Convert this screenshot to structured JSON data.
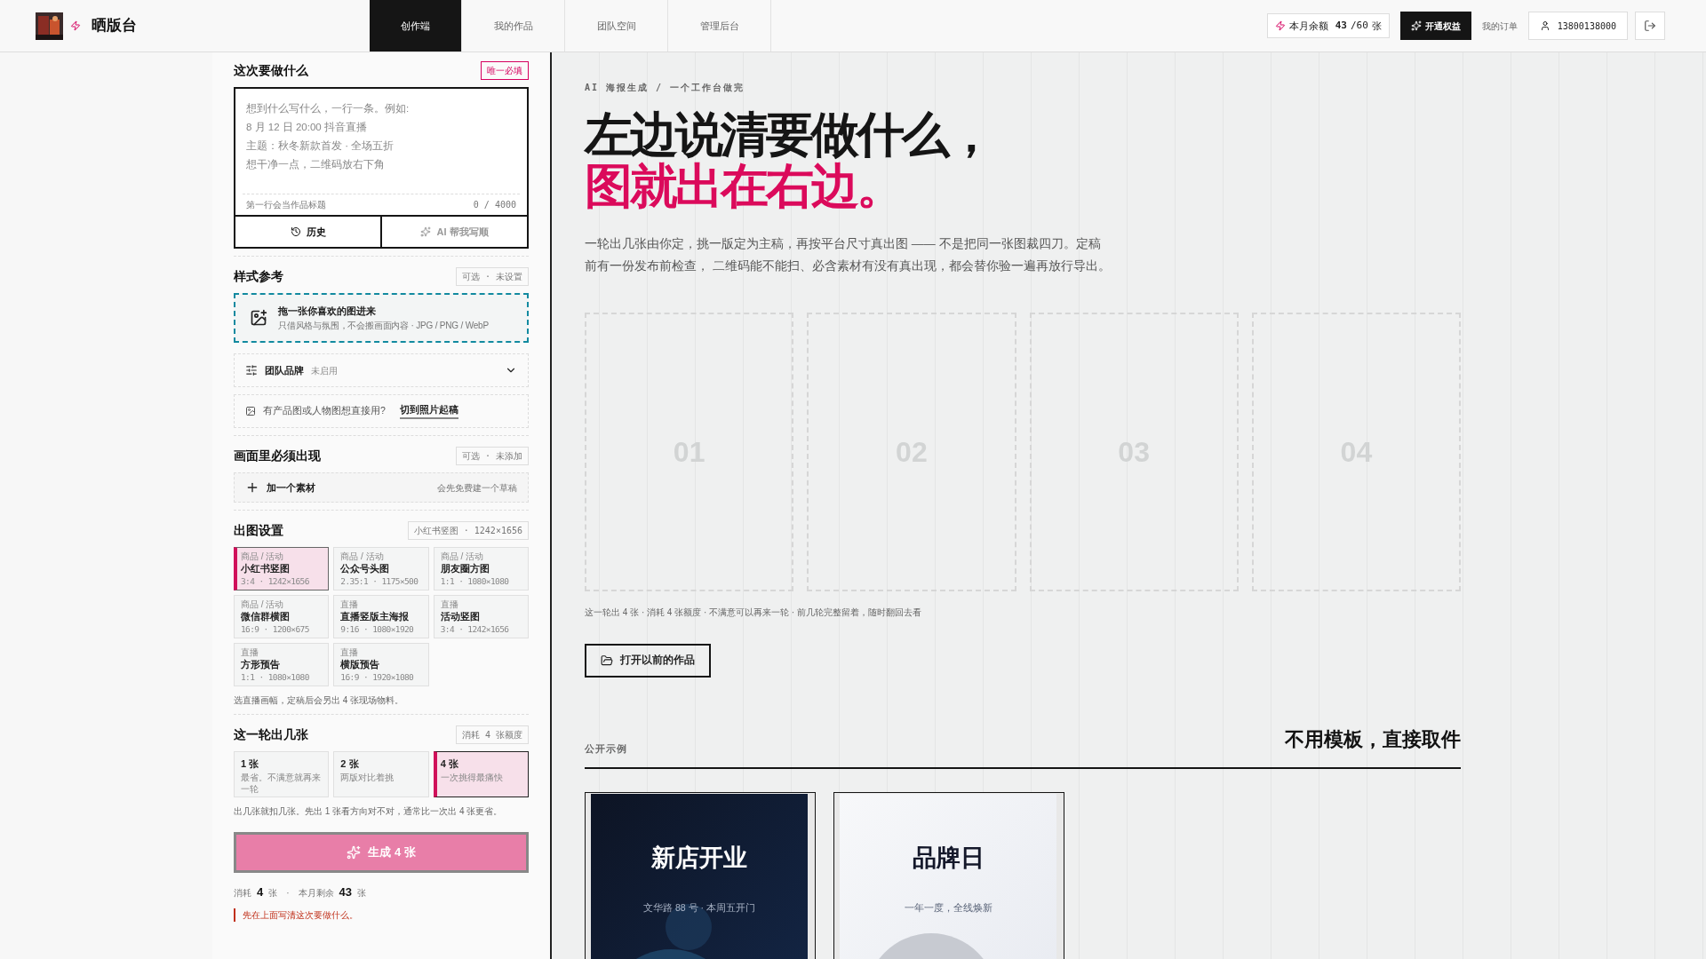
{
  "header": {
    "brand": "晒版台",
    "tabs": [
      {
        "label": "创作端",
        "selected": true
      },
      {
        "label": "我的作品",
        "selected": false
      },
      {
        "label": "团队空间",
        "selected": false
      },
      {
        "label": "管理后台",
        "selected": false
      }
    ],
    "quota": {
      "label": "本月余额",
      "value": "43",
      "total": "/60",
      "unit": "张"
    },
    "upgrade_button": "开通权益",
    "orders_link": "我的订单",
    "account": "13800138000"
  },
  "brief": {
    "title": "这次要做什么",
    "badge": "唯一必填",
    "placeholder": [
      "想到什么写什么，一行一条。例如:",
      "8 月 12 日 20:00 抖音直播",
      "主题：秋冬新款首发 · 全场五折",
      "想干净一点，二维码放右下角"
    ],
    "hint": "第一行会当作品标题",
    "counter": "0 / 4000",
    "buttons": [
      {
        "label": "历史",
        "kind": "history",
        "disabled": false
      },
      {
        "label": "AI 帮我写顺",
        "kind": "ai",
        "disabled": true
      }
    ]
  },
  "style_ref": {
    "title": "样式参考",
    "badge": "可选 · 未设置",
    "drop_title": "拖一张你喜欢的图进来",
    "drop_hint": "只借风格与氛围，不会搬画面内容 · JPG / PNG / WebP"
  },
  "team_brand": {
    "label": "团队品牌",
    "status": "未启用",
    "expanded": false
  },
  "photo_switch": {
    "question": "有产品图或人物图想直接用?",
    "link": "切到照片起稿"
  },
  "must_show": {
    "title": "画面里必须出现",
    "badge": "可选 · 未添加",
    "add_label": "加一个素材",
    "add_hint": "会先免费建一个草稿"
  },
  "output": {
    "title": "出图设置",
    "badge": "小红书竖图 · 1242×1656",
    "formats": [
      {
        "category": "商品 / 活动",
        "name": "小红书竖图",
        "spec": "3:4 · 1242×1656",
        "selected": true
      },
      {
        "category": "商品 / 活动",
        "name": "公众号头图",
        "spec": "2.35:1 · 1175×500",
        "selected": false
      },
      {
        "category": "商品 / 活动",
        "name": "朋友圈方图",
        "spec": "1:1 · 1080×1080",
        "selected": false
      },
      {
        "category": "商品 / 活动",
        "name": "微信群横图",
        "spec": "16:9 · 1200×675",
        "selected": false
      },
      {
        "category": "直播",
        "name": "直播竖版主海报",
        "spec": "9:16 · 1080×1920",
        "selected": false
      },
      {
        "category": "直播",
        "name": "活动竖图",
        "spec": "3:4 · 1242×1656",
        "selected": false
      },
      {
        "category": "直播",
        "name": "方形预告",
        "spec": "1:1 · 1080×1080",
        "selected": false
      },
      {
        "category": "直播",
        "name": "横版预告",
        "spec": "16:9 · 1920×1080",
        "selected": false
      }
    ],
    "note": "选直播画幅，定稿后会另出 4 张现场物料。"
  },
  "count": {
    "title": "这一轮出几张",
    "badge": "消耗 4 张额度",
    "options": [
      {
        "label": "1 张",
        "hint": "最省。不满意就再来一轮",
        "selected": false
      },
      {
        "label": "2 张",
        "hint": "两版对比着挑",
        "selected": false
      },
      {
        "label": "4 张",
        "hint": "一次挑得最痛快",
        "selected": true
      }
    ],
    "note": "出几张就扣几张。先出 1 张看方向对不对，通常比一次出 4 张更省。"
  },
  "generate_button": {
    "label": "生成 4 张",
    "disabled": true
  },
  "usage": {
    "cost_label": "消耗",
    "cost": "4",
    "cost_unit": "张",
    "separator": "·",
    "remain_label": "本月剩余",
    "remain": "43",
    "remain_unit": "张"
  },
  "error": "先在上面写清这次要做什么。",
  "hero": {
    "eyebrow": "AI 海报生成 / 一个工作台做完",
    "title_line1": "左边说清要做什么，",
    "title_line2": "图就出在右边。",
    "intro": "一轮出几张由你定，挑一版定为主稿，再按平台尺寸真出图 —— 不是把同一张图裁四刀。定稿前有一份发布前检查， 二维码能不能扫、必含素材有没有真出现，都会替你验一遍再放行导出。"
  },
  "slots": [
    {
      "label": "01"
    },
    {
      "label": "02"
    },
    {
      "label": "03"
    },
    {
      "label": "04"
    }
  ],
  "round_info": "这一轮出 4 张 · 消耗 4 张额度 · 不满意可以再来一轮 · 前几轮完整留着，随时翻回去看",
  "open_button": "打开以前的作品",
  "examples": {
    "label": "公开示例",
    "heading": "不用模板，直接取件",
    "items": [
      {
        "title": "新店开业",
        "subtitle": "文华路 88 号 · 本周五开门",
        "kind": "dark"
      },
      {
        "title": "品牌日",
        "subtitle": "一年一度，全线焕新",
        "kind": "light"
      }
    ]
  }
}
